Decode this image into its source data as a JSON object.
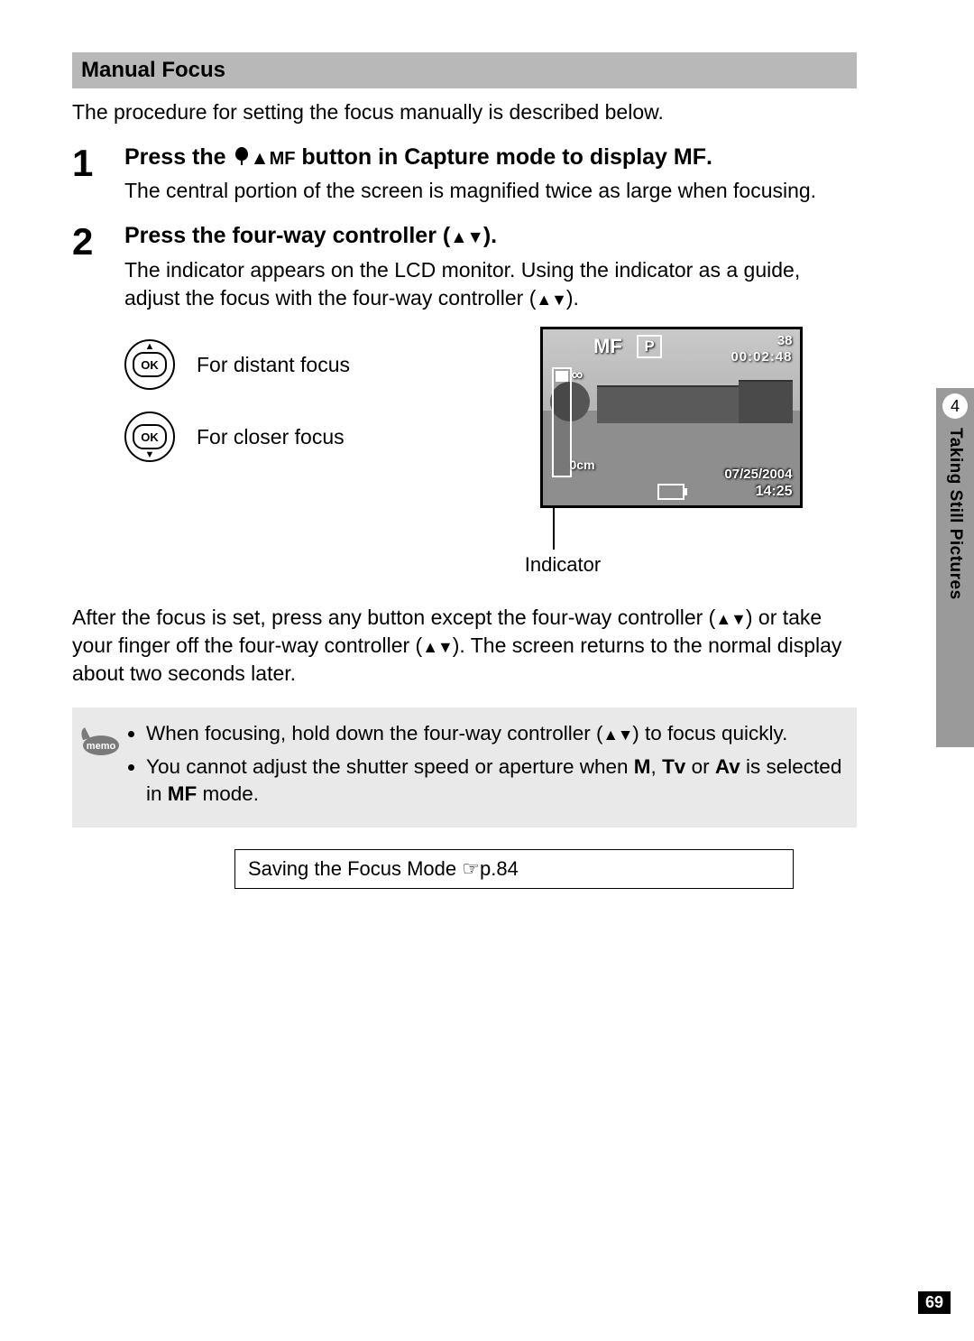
{
  "section_header": "Manual Focus",
  "intro": "The procedure for setting the focus manually is described below.",
  "step1": {
    "num": "1",
    "title_a": "Press the ",
    "title_b": " button in Capture mode to display ",
    "title_mf_small": "MF",
    "title_mf_end": "MF",
    "title_dot": ".",
    "text": "The central portion of the screen is magnified twice as large when focusing."
  },
  "step2": {
    "num": "2",
    "title_a": "Press the four-way controller (",
    "title_b": ").",
    "text_a": "The indicator appears on the LCD monitor. Using the indicator as a guide, adjust the focus with the four-way controller (",
    "text_b": ")."
  },
  "ok_label": "OK",
  "distant": "For distant focus",
  "closer": "For closer focus",
  "lcd": {
    "mf": "MF",
    "p": "P",
    "count": "38",
    "rec_time": "00:02:48",
    "inf": "∞",
    "zero": "0cm",
    "date": "07/25/2004",
    "clock": "14:25"
  },
  "indicator_label": "Indicator",
  "after_a": "After the focus is set, press any button except the four-way controller (",
  "after_b": ") or take your finger off the four-way controller (",
  "after_c": "). The screen returns to the normal display about two seconds later.",
  "memo": {
    "li1_a": "When focusing, hold down the four-way controller (",
    "li1_b": ") to focus quickly.",
    "li2_a": "You cannot adjust the shutter speed or aperture when ",
    "li2_m": "M",
    "li2_sep1": ", ",
    "li2_tv": "Tv",
    "li2_or": " or ",
    "li2_av": "Av",
    "li2_b": " is selected in ",
    "li2_mf": "MF",
    "li2_c": " mode."
  },
  "ref_a": "Saving the Focus Mode ",
  "ref_icon": "☞",
  "ref_b": "p.84",
  "tab": {
    "num": "4",
    "text": "Taking Still Pictures"
  },
  "page_number": "69"
}
